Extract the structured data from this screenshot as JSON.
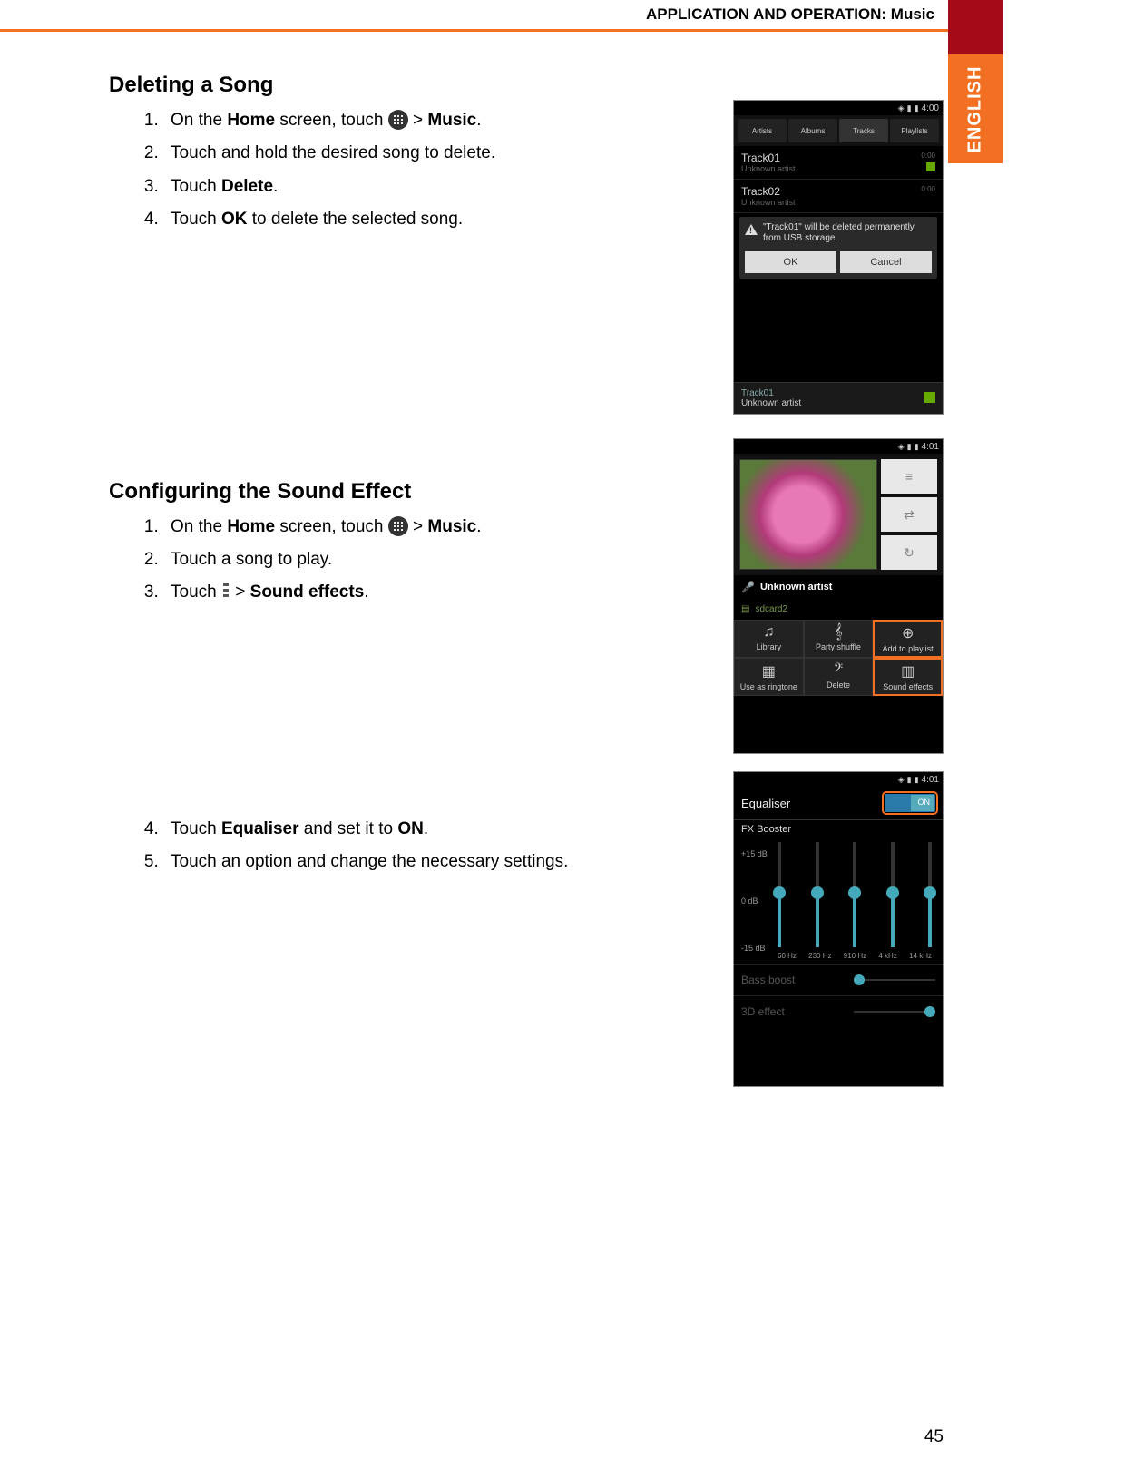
{
  "header": {
    "section_label": "APPLICATION AND OPERATION: Music",
    "language_tab": "ENGLISH",
    "page_number": "45"
  },
  "section1": {
    "heading": "Deleting a Song",
    "steps": {
      "s1_pre": "On the ",
      "s1_home": "Home",
      "s1_mid": " screen, touch ",
      "s1_gt": " > ",
      "s1_music": "Music",
      "s1_end": ".",
      "s2": "Touch and hold the desired song to delete.",
      "s3_pre": "Touch ",
      "s3_delete": "Delete",
      "s3_end": ".",
      "s4_pre": "Touch ",
      "s4_ok": "OK",
      "s4_end": " to delete the selected song."
    }
  },
  "section2": {
    "heading": "Configuring the Sound Effect",
    "steps": {
      "s1_pre": "On the ",
      "s1_home": "Home",
      "s1_mid": " screen, touch ",
      "s1_gt": " > ",
      "s1_music": "Music",
      "s1_end": ".",
      "s2": "Touch a song to play.",
      "s3_pre": "Touch ",
      "s3_gt": " > ",
      "s3_se": "Sound effects",
      "s3_end": ".",
      "s4_pre": "Touch ",
      "s4_eq": "Equaliser",
      "s4_mid": " and set it to ",
      "s4_on": "ON",
      "s4_end": ".",
      "s5": "Touch an option and change the necessary settings."
    }
  },
  "phone1": {
    "time": "4:00",
    "tabs": [
      "Artists",
      "Albums",
      "Tracks",
      "Playlists"
    ],
    "tracks": [
      {
        "name": "Track01",
        "artist": "Unknown artist",
        "dur": "0:00"
      },
      {
        "name": "Track02",
        "artist": "Unknown artist",
        "dur": "0:00"
      }
    ],
    "dialog_text": "\"Track01\" will be deleted permanently from USB storage.",
    "ok": "OK",
    "cancel": "Cancel",
    "now_playing": {
      "name": "Track01",
      "artist": "Unknown artist"
    }
  },
  "phone2": {
    "time": "4:01",
    "artist_label": "Unknown artist",
    "storage": "sdcard2",
    "menu": [
      "Library",
      "Party shuffle",
      "Add to playlist",
      "Use as ringtone",
      "Delete",
      "Sound effects"
    ]
  },
  "phone3": {
    "time": "4:01",
    "title": "Equaliser",
    "toggle": "ON",
    "fx": "FX Booster",
    "scale": [
      "+15 dB",
      "0 dB",
      "-15 dB"
    ],
    "freqs": [
      "60 Hz",
      "230 Hz",
      "910 Hz",
      "4 kHz",
      "14 kHz"
    ],
    "bass": "Bass boost",
    "three_d": "3D effect"
  }
}
